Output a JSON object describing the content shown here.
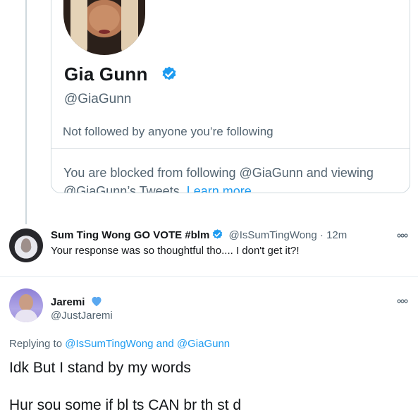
{
  "embed_card": {
    "name": "Gia Gunn",
    "handle": "@GiaGunn",
    "followed_text": "Not followed by anyone you’re following",
    "blocked_text": "You are blocked from following @GiaGunn and viewing @GiaGunn’s Tweets.",
    "learn_more": "Learn more"
  },
  "tweet1": {
    "display_name": "Sum Ting Wong GO VOTE #blm",
    "handle": "@IsSumTingWong",
    "separator": "·",
    "time": "12m",
    "text": "Your response was so thoughtful tho.... I don't get it?!"
  },
  "tweet2": {
    "display_name": "Jaremi",
    "handle": "@JustJaremi",
    "replying_prefix": "Replying to",
    "reply_user_1": "@IsSumTingWong",
    "reply_and": "and",
    "reply_user_2": "@GiaGunn",
    "text": "Idk But I stand by my words",
    "text_line2_partial": "Hur sou some  if bl ts CAN br  th st  d"
  },
  "colors": {
    "accent": "#1d9bf0",
    "secondary_text": "#536471",
    "border": "#cfd9de",
    "heart_blue": "#5aa8f0"
  },
  "icons": {
    "verified": "verified-badge-icon",
    "more": "more-options-icon",
    "heart": "blue-heart-icon"
  }
}
